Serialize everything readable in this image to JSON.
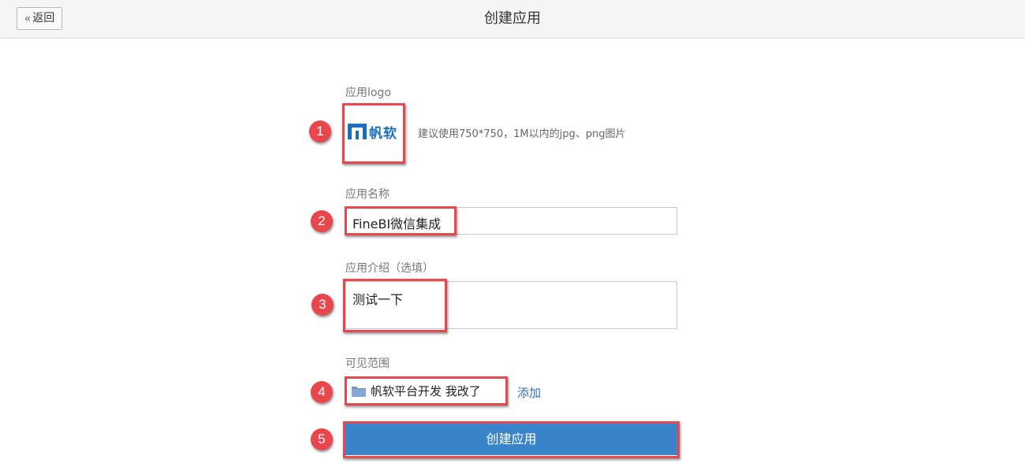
{
  "header": {
    "back_label": "返回",
    "title": "创建应用"
  },
  "form": {
    "logo": {
      "label": "应用logo",
      "logo_text": "帆软",
      "hint": "建议使用750*750，1M以内的jpg、png图片"
    },
    "name": {
      "label": "应用名称",
      "value": "FineBI微信集成"
    },
    "intro": {
      "label": "应用介绍（选填）",
      "value": "测试一下"
    },
    "scope": {
      "label": "可见范围",
      "item": "帆软平台开发 我改了",
      "add_label": "添加"
    },
    "submit_label": "创建应用"
  },
  "annotations": [
    "1",
    "2",
    "3",
    "4",
    "5"
  ],
  "colors": {
    "annotation_red": "#e8474d",
    "primary_button": "#3a84c9",
    "link": "#3a6fb0",
    "brand_blue": "#1a6fbf"
  }
}
